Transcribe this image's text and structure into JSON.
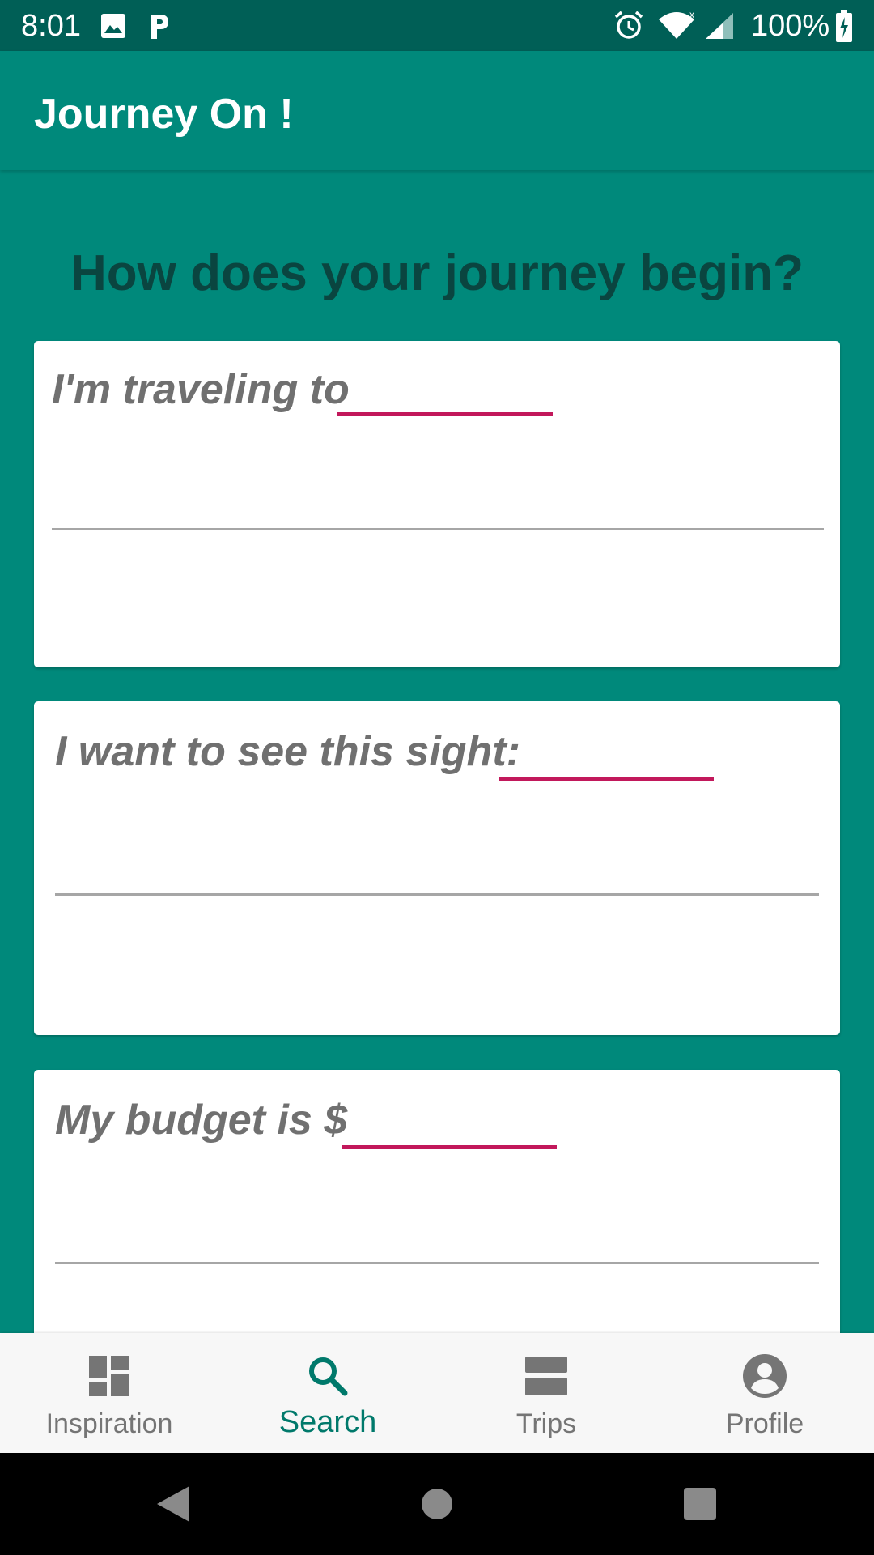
{
  "status_bar": {
    "time": "8:01",
    "battery": "100%"
  },
  "app_bar": {
    "title": "Journey On !"
  },
  "main": {
    "question": "How does your journey begin?",
    "cards": [
      {
        "label": "I'm traveling to",
        "input_value": ""
      },
      {
        "label": "I want to see this sight:",
        "input_value": ""
      },
      {
        "label": "My budget is $",
        "input_value": ""
      }
    ]
  },
  "bottom_nav": {
    "items": [
      {
        "label": "Inspiration",
        "icon": "dashboard-icon",
        "active": false
      },
      {
        "label": "Search",
        "icon": "search-icon",
        "active": true
      },
      {
        "label": "Trips",
        "icon": "view-agenda-icon",
        "active": false
      },
      {
        "label": "Profile",
        "icon": "account-circle-icon",
        "active": false
      }
    ]
  },
  "colors": {
    "primary": "#00897b",
    "primary_dark": "#005f56",
    "accent": "#c2185b",
    "question_text": "#0a4540",
    "active_nav": "#00796b"
  }
}
